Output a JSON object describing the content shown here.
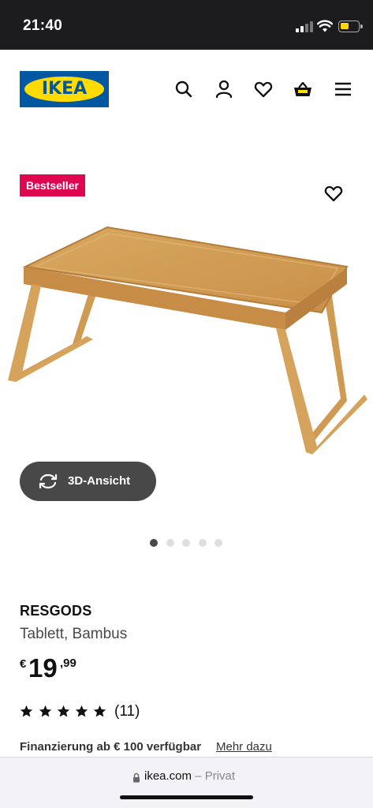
{
  "status_bar": {
    "time": "21:40"
  },
  "header": {
    "logo_text": "IKEA",
    "icons": [
      "search-icon",
      "account-icon",
      "heart-icon",
      "basket-icon",
      "menu-icon"
    ]
  },
  "product": {
    "badge": "Bestseller",
    "view_3d_label": "3D-Ansicht",
    "image_dots": 5,
    "active_dot": 1,
    "name": "RESGODS",
    "description": "Tablett, Bambus",
    "price": {
      "currency": "€",
      "integer": "19",
      "decimals": ",99"
    },
    "rating": {
      "stars": 5,
      "count": "(11)"
    },
    "financing_text": "Finanzierung ab € 100 verfügbar",
    "financing_link": "Mehr dazu"
  },
  "browser": {
    "domain": "ikea.com",
    "mode": "– Privat"
  },
  "colors": {
    "badge_bg": "#e00751",
    "ikea_blue": "#0058a3",
    "ikea_yellow": "#ffdb00",
    "button_dark": "#484848"
  }
}
